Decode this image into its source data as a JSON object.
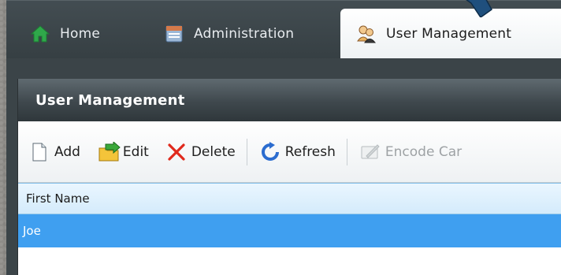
{
  "tabs": [
    {
      "label": "Home",
      "icon": "home-icon"
    },
    {
      "label": "Administration",
      "icon": "administration-icon"
    },
    {
      "label": "User Management",
      "icon": "users-icon",
      "active": true
    }
  ],
  "window": {
    "title": "User Management"
  },
  "toolbar": {
    "add_label": "Add",
    "edit_label": "Edit",
    "delete_label": "Delete",
    "refresh_label": "Refresh",
    "encode_label": "Encode Car"
  },
  "grid": {
    "columns": [
      "First Name"
    ],
    "rows": [
      [
        "Joe"
      ]
    ]
  },
  "colors": {
    "tabbar": "#3b4448",
    "selection": "#3f9ff0",
    "header": "#d4ebfb",
    "home_icon": "#2fa84a",
    "delete_icon": "#e0291c",
    "refresh_icon": "#2b6ccf"
  }
}
